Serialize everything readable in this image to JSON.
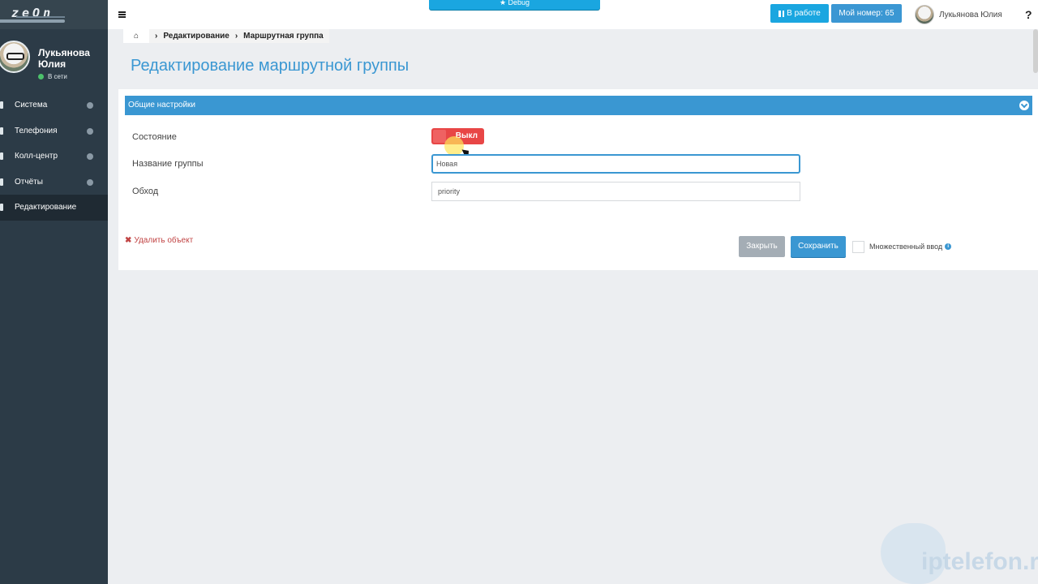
{
  "logo": {
    "text": "zeOn"
  },
  "sidebar": {
    "user_name": "Лукьянова Юлия",
    "status": "В сети",
    "items": [
      {
        "label": "Система",
        "icon": "system-icon"
      },
      {
        "label": "Телефония",
        "icon": "phone-icon"
      },
      {
        "label": "Колл-центр",
        "icon": "headset-icon"
      },
      {
        "label": "Отчёты",
        "icon": "report-icon"
      },
      {
        "label": "Редактирование",
        "icon": "edit-icon",
        "active": true
      }
    ]
  },
  "topbar": {
    "debug_label": "★ Debug",
    "work_label": "В работе",
    "my_number_label": "Мой номер: 65",
    "user_name": "Лукьянова Юлия",
    "help": "?"
  },
  "breadcrumb": {
    "items": [
      "Редактирование",
      "Маршрутная группа"
    ]
  },
  "page": {
    "title": "Редактирование маршрутной группы"
  },
  "panel": {
    "header": "Общие настройки",
    "fields": {
      "state_label": "Состояние",
      "state_value": "Выкл",
      "group_name_label": "Название группы",
      "group_name_value": "Новая",
      "traversal_label": "Обход",
      "traversal_value": "priority"
    },
    "delete_label": "Удалить объект",
    "close_label": "Закрыть",
    "save_label": "Сохранить",
    "multi_input_label": "Множественный ввод"
  },
  "colors": {
    "accent": "#3a97d2",
    "sidebar_bg": "#2c3b47",
    "toggle_off": "#e84646",
    "button_cyan": "#1aa6e0"
  },
  "watermark": {
    "text": "iptelefon.r"
  }
}
